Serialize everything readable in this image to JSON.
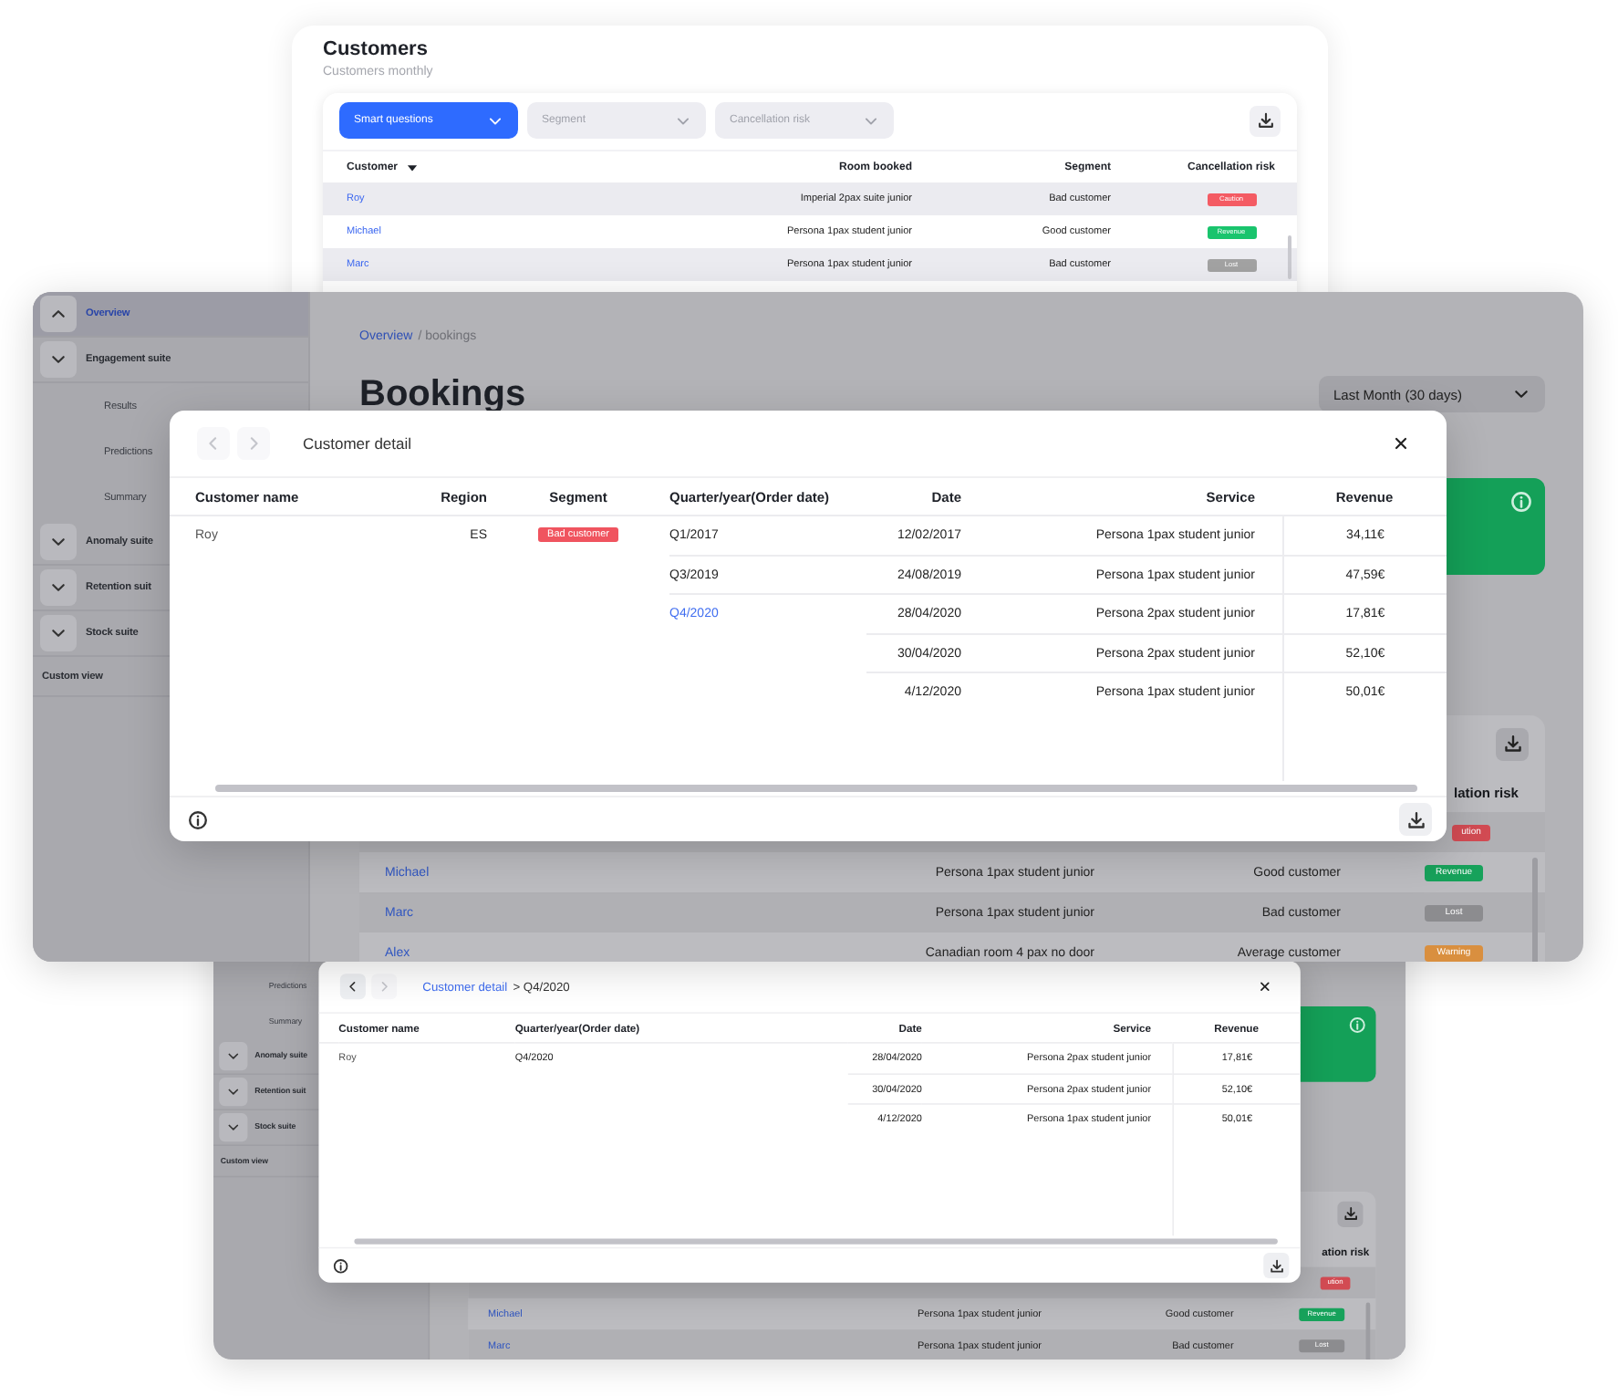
{
  "customers_panel": {
    "title": "Customers",
    "subtitle": "Customers monthly",
    "filters": [
      {
        "label": "Smart questions",
        "selected": true
      },
      {
        "label": "Segment",
        "selected": false
      },
      {
        "label": "Cancellation risk",
        "selected": false
      }
    ],
    "columns": [
      {
        "label": "Customer",
        "kind": "customer",
        "sorted": true
      },
      {
        "label": "Room booked",
        "kind": "room",
        "sorted": false
      },
      {
        "label": "Segment",
        "kind": "segment",
        "sorted": false
      },
      {
        "label": "Cancellation risk",
        "kind": "risk",
        "sorted": false
      }
    ],
    "rows": [
      {
        "customer": "Roy",
        "room": "Imperial 2pax suite junior",
        "segment": "Bad customer",
        "risk": {
          "label": "Caution",
          "color": "#f45b63"
        }
      },
      {
        "customer": "Michael",
        "room": "Persona 1pax student junior",
        "segment": "Good customer",
        "risk": {
          "label": "Revenue",
          "color": "#19c46d"
        }
      },
      {
        "customer": "Marc",
        "room": "Persona 1pax student junior",
        "segment": "Bad customer",
        "risk": {
          "label": "Lost",
          "color": "#a2a2a2"
        }
      }
    ]
  },
  "bookings_screen": {
    "sidebar": [
      {
        "label": "Overview",
        "kind": "group",
        "selected": true,
        "expanded": true
      },
      {
        "label": "Engagement suite",
        "kind": "group",
        "selected": false,
        "expanded": false,
        "children": [
          {
            "label": "Results",
            "kind": "sub",
            "selected": false
          },
          {
            "label": "Predictions",
            "kind": "sub",
            "selected": false
          },
          {
            "label": "Summary",
            "kind": "sub",
            "selected": false
          }
        ]
      },
      {
        "label": "Anomaly suite",
        "kind": "group",
        "selected": false,
        "expanded": false
      },
      {
        "label": "Retention suit",
        "kind": "group",
        "selected": false,
        "expanded": false
      },
      {
        "label": "Stock suite",
        "kind": "group",
        "selected": false,
        "expanded": false
      },
      {
        "label": "Custom view",
        "kind": "plain",
        "selected": false
      }
    ],
    "breadcrumb": {
      "link": "Overview",
      "current": "/ bookings"
    },
    "title": "Bookings",
    "period": "Last Month (30 days)",
    "table": {
      "risk_header": "lation risk",
      "rows": [
        {
          "risk": {
            "label": "ution",
            "color": "#d24b53"
          }
        },
        {
          "customer": "Michael",
          "room": "Persona 1pax student junior",
          "segment": "Good customer",
          "risk": {
            "label": "Revenue",
            "color": "#17a25b"
          }
        },
        {
          "customer": "Marc",
          "room": "Persona 1pax student junior",
          "segment": "Bad customer",
          "risk": {
            "label": "Lost",
            "color": "#8c8c8f"
          }
        },
        {
          "customer": "Alex",
          "room": "Canadian room 4 pax no door",
          "segment": "Average customer",
          "risk": {
            "label": "Warning",
            "color": "#d98f3f"
          }
        }
      ]
    },
    "modal": {
      "back": {
        "disabled": true
      },
      "forward": {
        "disabled": true
      },
      "title": [
        {
          "text": "Customer detail",
          "kind": "plain"
        }
      ],
      "columns": [
        {
          "label": "Customer name",
          "kind": "name"
        },
        {
          "label": "Region",
          "kind": "region"
        },
        {
          "label": "Segment",
          "kind": "segment"
        },
        {
          "label": "Quarter/year(Order date)",
          "kind": "quarter"
        },
        {
          "label": "Date",
          "kind": "date"
        },
        {
          "label": "Service",
          "kind": "service"
        },
        {
          "label": "Revenue",
          "kind": "revenue"
        }
      ],
      "customer": {
        "name": "Roy",
        "region": "ES",
        "segment": {
          "label": "Bad customer",
          "color": "#f0545f"
        }
      },
      "quarters": [
        {
          "label": "Q1/2017",
          "link": false,
          "orders": [
            {
              "date": "12/02/2017",
              "service": "Persona 1pax student junior",
              "revenue": "34,11€"
            }
          ]
        },
        {
          "label": "Q3/2019",
          "link": false,
          "orders": [
            {
              "date": "24/08/2019",
              "service": "Persona 1pax student junior",
              "revenue": "47,59€"
            }
          ]
        },
        {
          "label": "Q4/2020",
          "link": true,
          "orders": [
            {
              "date": "28/04/2020",
              "service": "Persona 2pax student junior",
              "revenue": "17,81€"
            },
            {
              "date": "30/04/2020",
              "service": "Persona 2pax student junior",
              "revenue": "52,10€"
            },
            {
              "date": "4/12/2020",
              "service": "Persona 1pax student junior",
              "revenue": "50,01€"
            }
          ]
        }
      ]
    }
  },
  "quarter_screen": {
    "sidebar": [
      {
        "label": "Predictions",
        "kind": "sub",
        "selected": false
      },
      {
        "label": "Summary",
        "kind": "sub",
        "selected": false
      },
      {
        "label": "Anomaly suite",
        "kind": "group",
        "selected": false,
        "expanded": false
      },
      {
        "label": "Retention suit",
        "kind": "group",
        "selected": false,
        "expanded": false
      },
      {
        "label": "Stock suite",
        "kind": "group",
        "selected": false,
        "expanded": false
      },
      {
        "label": "Custom view",
        "kind": "plain",
        "selected": false
      }
    ],
    "table": {
      "risk_header": "ation risk",
      "rows": [
        {
          "risk": {
            "label": "ution",
            "color": "#d24b53"
          }
        },
        {
          "customer": "Michael",
          "room": "Persona 1pax student junior",
          "segment": "Good customer",
          "risk": {
            "label": "Revenue",
            "color": "#17a25b"
          }
        },
        {
          "customer": "Marc",
          "room": "Persona 1pax student junior",
          "segment": "Bad customer",
          "risk": {
            "label": "Lost",
            "color": "#8c8c8f"
          }
        }
      ]
    },
    "modal": {
      "back": {
        "disabled": false
      },
      "forward": {
        "disabled": true
      },
      "title": [
        {
          "text": "Customer detail",
          "kind": "link"
        },
        {
          "text": "> Q4/2020",
          "kind": "plain"
        }
      ],
      "columns": [
        {
          "label": "Customer name",
          "kind": "name"
        },
        {
          "label": "Quarter/year(Order date)",
          "kind": "quarter"
        },
        {
          "label": "Date",
          "kind": "date"
        },
        {
          "label": "Service",
          "kind": "service"
        },
        {
          "label": "Revenue",
          "kind": "revenue"
        }
      ],
      "customer": {
        "name": "Roy"
      },
      "quarters": [
        {
          "label": "Q4/2020",
          "link": false,
          "orders": [
            {
              "date": "28/04/2020",
              "service": "Persona 2pax student junior",
              "revenue": "17,81€"
            },
            {
              "date": "30/04/2020",
              "service": "Persona 2pax student junior",
              "revenue": "52,10€"
            },
            {
              "date": "4/12/2020",
              "service": "Persona 1pax student junior",
              "revenue": "50,01€"
            }
          ]
        }
      ]
    }
  }
}
